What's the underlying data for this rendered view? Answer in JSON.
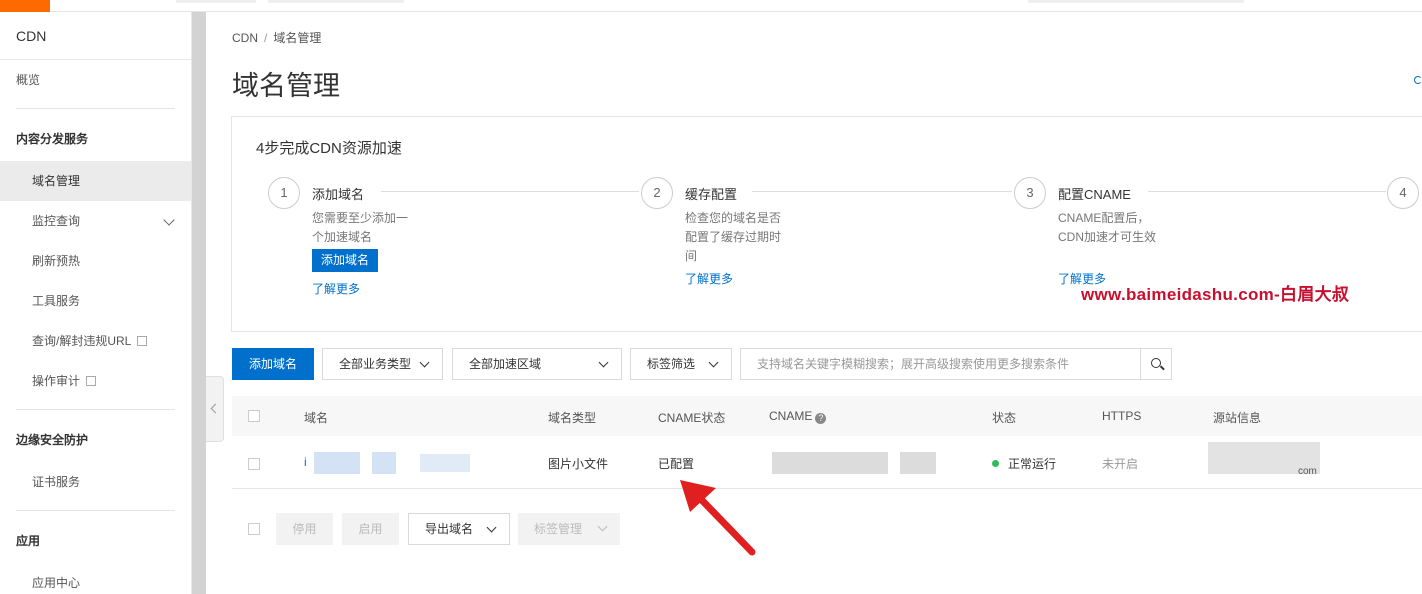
{
  "sidebar": {
    "title": "CDN",
    "overview": "概览",
    "group_content": "内容分发服务",
    "items": [
      "域名管理",
      "监控查询",
      "刷新预热",
      "工具服务",
      "查询/解封违规URL",
      "操作审计"
    ],
    "group_security": "边缘安全防护",
    "security_items": [
      "证书服务"
    ],
    "group_app": "应用",
    "app_items": [
      "应用中心"
    ]
  },
  "breadcrumb": {
    "root": "CDN",
    "sep": "/",
    "current": "域名管理"
  },
  "page_title": "域名管理",
  "guide": {
    "title": "4步完成CDN资源加速",
    "steps": [
      {
        "num": "1",
        "title": "添加域名",
        "desc": "您需要至少添加一个加速域名",
        "button": "添加域名",
        "link": "了解更多"
      },
      {
        "num": "2",
        "title": "缓存配置",
        "desc": "检查您的域名是否配置了缓存过期时间",
        "link": "了解更多"
      },
      {
        "num": "3",
        "title": "配置CNAME",
        "desc": "CNAME配置后，CDN加速才可生效",
        "link": "了解更多"
      },
      {
        "num": "4"
      }
    ]
  },
  "watermark": "www.baimeidashu.com-白眉大叔",
  "toolbar": {
    "add_domain": "添加域名",
    "business_type": "全部业务类型",
    "region": "全部加速区域",
    "tag_filter": "标签筛选",
    "search_placeholder": "支持域名关键字模糊搜索；展开高级搜索使用更多搜索条件"
  },
  "table": {
    "headers": [
      "域名",
      "域名类型",
      "CNAME状态",
      "CNAME",
      "状态",
      "HTTPS",
      "源站信息"
    ],
    "rows": [
      {
        "domain_prefix": "i",
        "type": "图片小文件",
        "cname_status": "已配置",
        "status": "正常运行",
        "https": "未开启",
        "origin_suffix": "com"
      }
    ]
  },
  "bottom_actions": {
    "disable": "停用",
    "enable": "启用",
    "export": "导出域名",
    "tag_manage": "标签管理"
  },
  "colors": {
    "primary": "#0070cc",
    "brand": "#ff6a00",
    "running": "#2fbc58",
    "annotation": "#e02020",
    "watermark": "#c8102e"
  }
}
